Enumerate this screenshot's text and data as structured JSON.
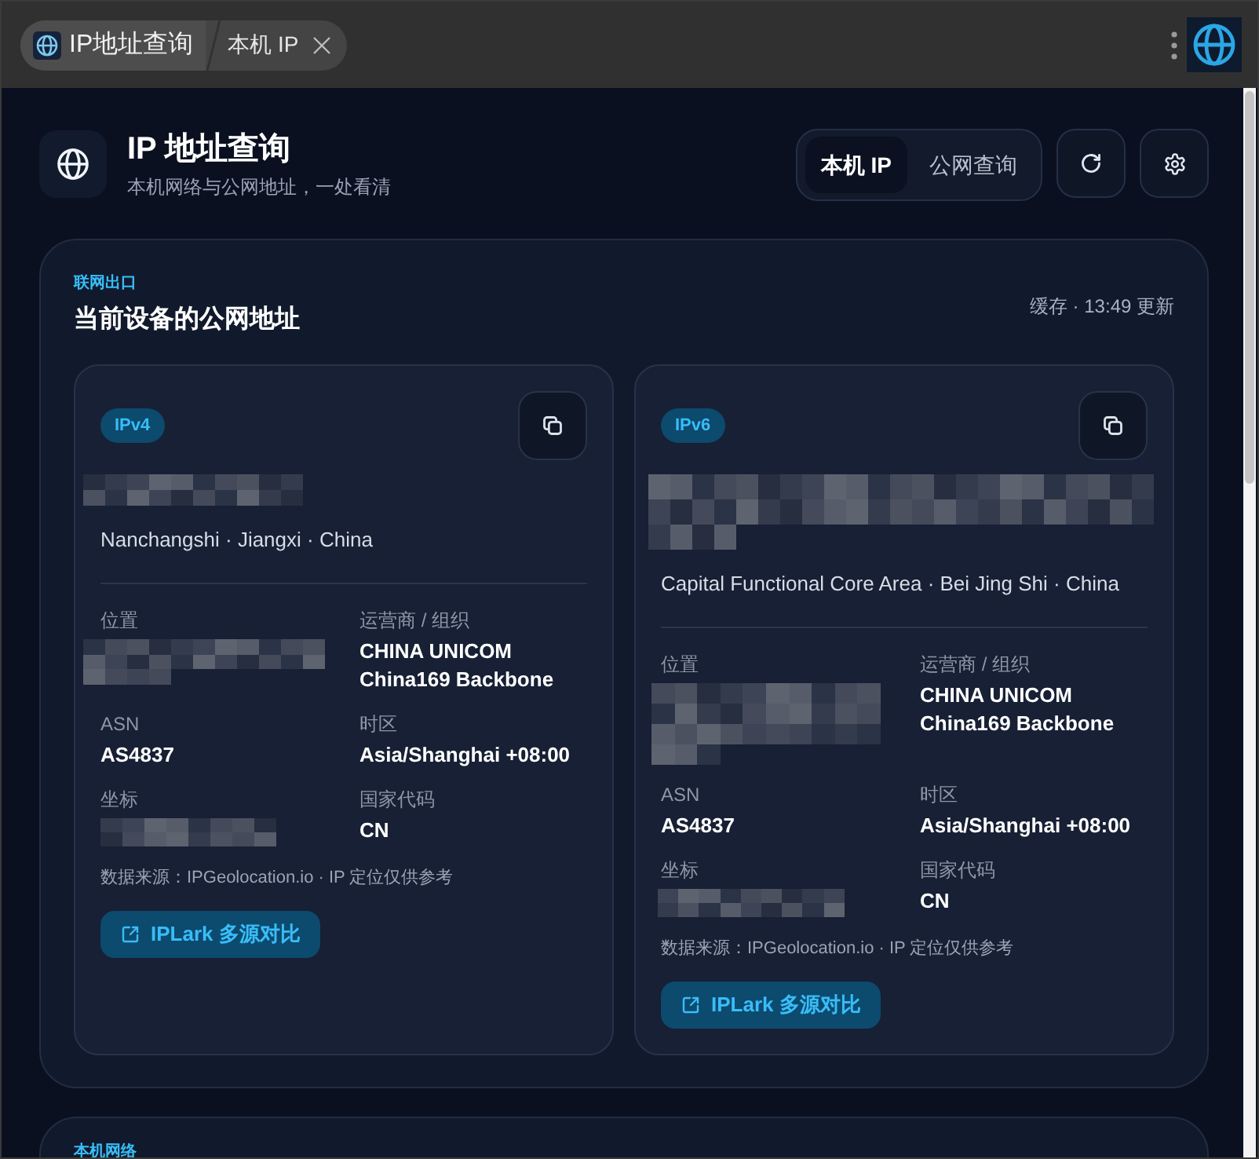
{
  "title_bar": {
    "app_name": "IP地址查询",
    "page_title": "本机 IP"
  },
  "header": {
    "title": "IP 地址查询",
    "subtitle": "本机网络与公网地址，一处看清"
  },
  "view_tabs": [
    {
      "label": "本机 IP",
      "selected": true
    },
    {
      "label": "公网查询",
      "selected": false
    }
  ],
  "sections": [
    {
      "eyebrow": "联网出口",
      "title": "当前设备的公网地址",
      "status": "缓存 · 13:49 更新",
      "cards": [
        {
          "badge": "IPv4",
          "address": {
            "kind": "redacted"
          },
          "location": "Nanchangshi · Jiangxi · China",
          "fields": [
            {
              "label": "位置",
              "kind": "redacted"
            },
            {
              "label": "运营商 / 组织",
              "kind": "text",
              "value": "CHINA UNICOM China169 Backbone"
            },
            {
              "label": "ASN",
              "kind": "text",
              "value": "AS4837"
            },
            {
              "label": "时区",
              "kind": "text",
              "value": "Asia/Shanghai +08:00"
            },
            {
              "label": "坐标",
              "kind": "redacted"
            },
            {
              "label": "国家代码",
              "kind": "text",
              "value": "CN"
            }
          ],
          "source": "数据来源：IPGeolocation.io · IP 定位仅供参考",
          "action": "IPLark 多源对比"
        },
        {
          "badge": "IPv6",
          "address": {
            "kind": "redacted"
          },
          "location": "Capital Functional Core Area · Bei Jing Shi · China",
          "fields": [
            {
              "label": "位置",
              "kind": "redacted"
            },
            {
              "label": "运营商 / 组织",
              "kind": "text",
              "value": "CHINA UNICOM China169 Backbone"
            },
            {
              "label": "ASN",
              "kind": "text",
              "value": "AS4837"
            },
            {
              "label": "时区",
              "kind": "text",
              "value": "Asia/Shanghai +08:00"
            },
            {
              "label": "坐标",
              "kind": "redacted"
            },
            {
              "label": "国家代码",
              "kind": "text",
              "value": "CN"
            }
          ],
          "source": "数据来源：IPGeolocation.io · IP 定位仅供参考",
          "action": "IPLark 多源对比"
        }
      ]
    },
    {
      "eyebrow": "本机网络"
    }
  ]
}
